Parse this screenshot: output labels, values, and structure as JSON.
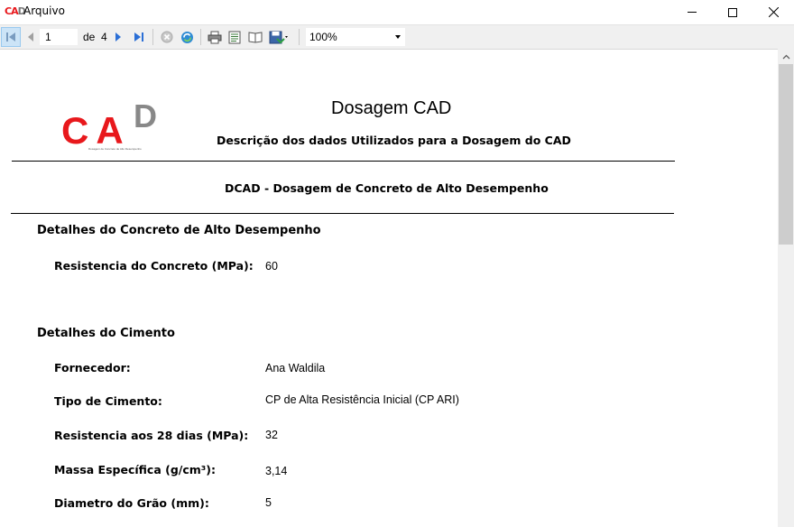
{
  "window": {
    "title": "Arquivo",
    "icon": "cad-app-icon"
  },
  "toolbar": {
    "current_page": "1",
    "of_label": "de",
    "total_pages": "4",
    "zoom": "100%"
  },
  "report": {
    "logo_text": "CA",
    "logo_d": "D",
    "logo_subtitle": "Dosagem de Concreto de Alto Desempenho",
    "title": "Dosagem CAD",
    "subtitle": "Descrição dos dados Utilizados para a Dosagem do CAD",
    "heading": "DCAD - Dosagem de Concreto de Alto Desempenho",
    "sections": [
      {
        "title": "Detalhes do Concreto de Alto Desempenho",
        "fields": [
          {
            "label": "Resistencia do Concreto (MPa):",
            "value": "60"
          }
        ]
      },
      {
        "title": "Detalhes do Cimento",
        "fields": [
          {
            "label": "Fornecedor:",
            "value": "Ana Waldila"
          },
          {
            "label": "Tipo de Cimento:",
            "value": "CP de Alta Resistência Inicial (CP ARI)"
          },
          {
            "label": "Resistencia aos 28 dias (MPa):",
            "value": "32"
          },
          {
            "label": "Massa Específica (g/cm³):",
            "value": "3,14"
          },
          {
            "label": "Diametro do Grão (mm):",
            "value": "5"
          }
        ]
      }
    ]
  }
}
